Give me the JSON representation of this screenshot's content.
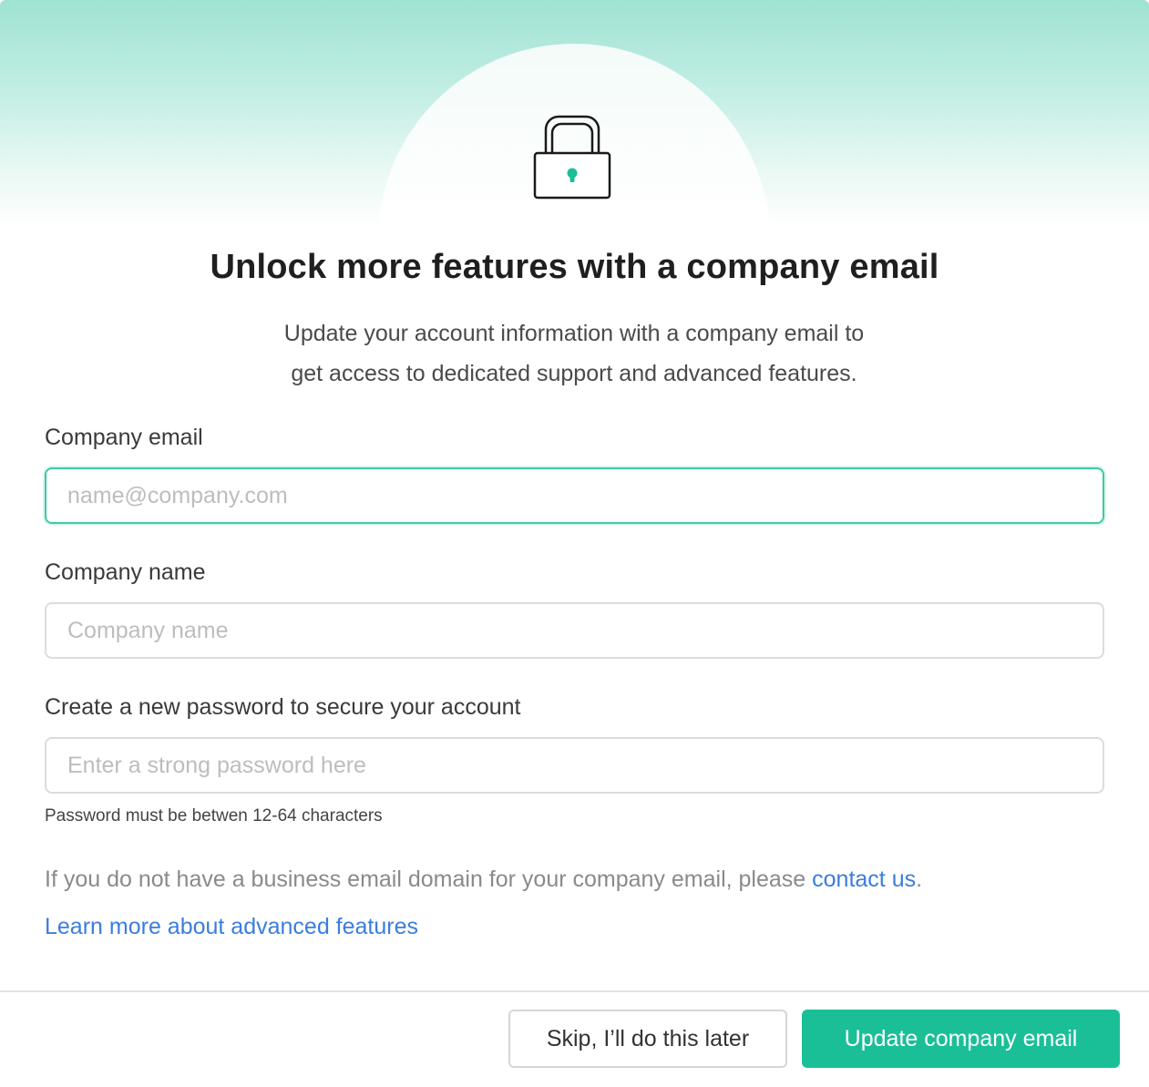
{
  "header": {
    "title": "Unlock more features with a company email",
    "subtitle_line1": "Update your account information with a company email to",
    "subtitle_line2": "get access to dedicated support and advanced features."
  },
  "form": {
    "email": {
      "label": "Company email",
      "placeholder": "name@company.com",
      "value": ""
    },
    "company": {
      "label": "Company name",
      "placeholder": "Company name",
      "value": ""
    },
    "password": {
      "label": "Create a new password to secure your account",
      "placeholder": "Enter a strong password here",
      "value": "",
      "hint": "Password must be betwen 12-64 characters"
    }
  },
  "note": {
    "text": "If you do not have a business email domain for your company email, please ",
    "link": "contact us",
    "suffix": "."
  },
  "learn_more": "Learn more about advanced features",
  "footer": {
    "skip_label": "Skip, I’ll do this later",
    "submit_label": "Update company email"
  },
  "colors": {
    "accent": "#1abf98",
    "focus_border": "#3cc9a6",
    "link": "#3b7ddd",
    "hero_top": "#9fe3d3"
  },
  "icons": {
    "hero": "lock-icon"
  }
}
